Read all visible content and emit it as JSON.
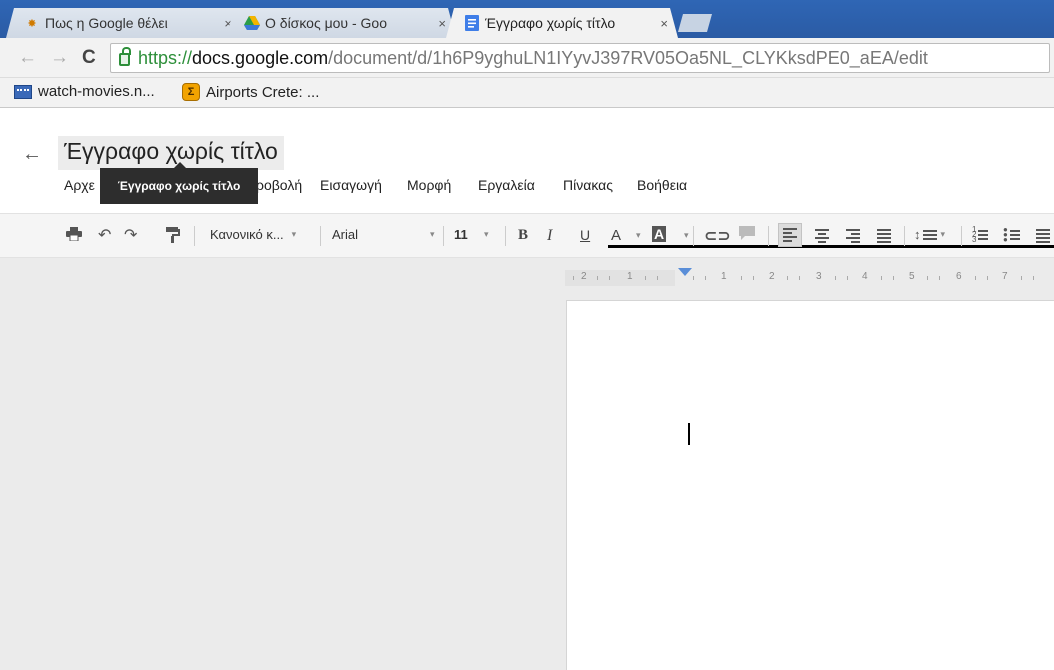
{
  "browser": {
    "tabs": [
      {
        "title": "Πως η Google θέλει",
        "favicon": "cartoon-icon"
      },
      {
        "title": "Ο δίσκος μου - Goo",
        "favicon": "drive-icon"
      },
      {
        "title": "Έγγραφο χωρίς τίτλο",
        "favicon": "docs-icon"
      }
    ],
    "close_glyph": "×",
    "url": {
      "scheme": "https://",
      "host": "docs.google.com",
      "path": "/document/d/1h6P9yghuLN1IYyvJ397RV05Oa5NL_CLYKksdPE0_aEA/edit"
    },
    "bookmarks": [
      {
        "label": "watch-movies.n...",
        "icon": "film-icon"
      },
      {
        "label": "Airports Crete: ...",
        "icon": "sigma-icon"
      }
    ]
  },
  "docs": {
    "back_glyph": "←",
    "title": "Έγγραφο χωρίς τίτλο",
    "tooltip": "Έγγραφο χωρίς τίτλο",
    "menu": [
      "Αρχεί",
      "",
      "προβολή",
      "Εισαγωγή",
      "Μορφή",
      "Εργαλεία",
      "Πίνακας",
      "Βοήθεια"
    ],
    "menu_visible": {
      "file": "Αρχε",
      "view": "ροβολή",
      "insert": "Εισαγωγή",
      "format": "Μορφή",
      "tools": "Εργαλεία",
      "table": "Πίνακας",
      "help": "Βοήθεια"
    },
    "toolbar": {
      "style": "Κανονικό κ...",
      "font": "Arial",
      "size": "11",
      "bold": "B",
      "italic": "I",
      "underline": "U",
      "text_color": "A",
      "highlight": "A"
    },
    "ruler_labels": [
      "2",
      "1",
      "1",
      "2",
      "3",
      "4",
      "5",
      "6",
      "7"
    ]
  },
  "colors": {
    "tabstrip": "#2b5ea8",
    "secure_green": "#2d8f3a",
    "tooltip_bg": "#2d2d2d",
    "workarea": "#ebebeb"
  }
}
